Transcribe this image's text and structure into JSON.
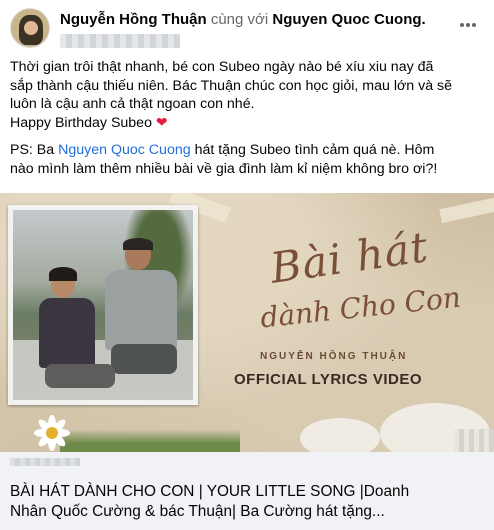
{
  "post": {
    "author": "Nguyễn Hồng Thuận",
    "with_text": "cùng với",
    "tagged": "Nguyen Quoc Cuong",
    "period": ".",
    "more_icon": "more-horizontal-icon",
    "body": {
      "line1": "Thời gian trôi thật nhanh, bé con Subeo ngày nào bé xíu xiu nay đã",
      "line2": "sắp thành cậu thiếu niên. Bác Thuận chúc con học giỏi, mau lớn và sẽ",
      "line3": "luôn là cậu anh cả thật ngoan con nhé.",
      "line4": "Happy Birthday Subeo",
      "heart": "❤",
      "ps_prefix": "PS: Ba ",
      "ps_link": "Nguyen Quoc Cuong",
      "ps_rest_1": " hát tặng Subeo tình cảm quá nè. Hôm",
      "ps_line2": "nào mình làm thêm nhiều bài về gia đình làm kỉ niệm không bro ơi?!"
    }
  },
  "video": {
    "script_line1": "Bài hát",
    "script_line2": "dành Cho Con",
    "artist": "NGUYỄN HỒNG THUẬN",
    "subtitle": "OFFICIAL LYRICS VIDEO"
  },
  "link_caption": {
    "line1": "BÀI HÁT DÀNH CHO CON | YOUR LITTLE SONG |Doanh",
    "line2": "Nhân Quốc Cường & bác Thuận| Ba Cường hát tặng..."
  },
  "colors": {
    "link": "#216fdb",
    "heart": "#e41e3f",
    "caption_bg": "#f0f2f5"
  }
}
